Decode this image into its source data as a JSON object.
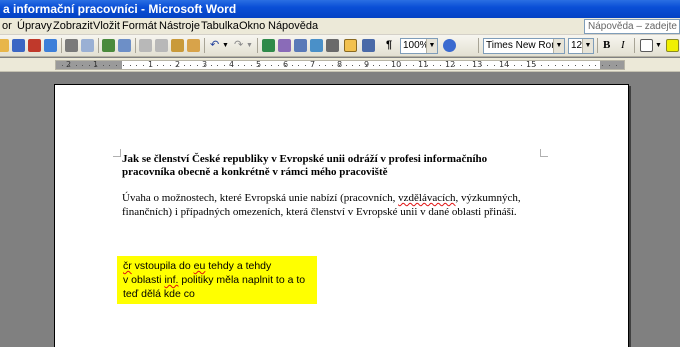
{
  "window": {
    "title": "a informační pracovníci - Microsoft Word"
  },
  "menu": {
    "items": [
      "or",
      "Úpravy",
      "Zobrazit",
      "Vložit",
      "Formát",
      "Nástroje",
      "Tabulka",
      "Okno",
      "Nápověda"
    ],
    "help_placeholder": "Nápověda – zadejte dotaz"
  },
  "toolbar": {
    "zoom": "100%",
    "font_name": "Times New Roman",
    "font_size": "12",
    "bold_label": "B",
    "italic_label": "I",
    "pilcrow": "¶"
  },
  "ruler": {
    "numbers": [
      "2",
      "1",
      "1",
      "2",
      "3",
      "4",
      "5",
      "6",
      "7",
      "8",
      "9",
      "10",
      "11",
      "12",
      "13",
      "14",
      "15"
    ]
  },
  "document": {
    "heading_line1": "Jak se členství České republiky v Evropské unii odráží v profesi informačního",
    "heading_line2": "pracovníka obecně a konkrétně v rámci mého pracoviště",
    "para_line1_a": "Úvaha o možnostech, které Evropská unie nabízí (pracovních, ",
    "para_line1_b": "vzdělávacích",
    "para_line1_c": ", výzkumných,",
    "para_line2": "finančních) i případných omezeních, která členství v Evropské unii v dané oblasti přináší.",
    "note_line1_a": "čr",
    "note_line1_b": " vstoupila do ",
    "note_line1_c": "eu",
    "note_line1_d": " tehdy a tehdy",
    "note_line2_a": "v oblasti ",
    "note_line2_b": "inf.",
    "note_line2_c": " politiky měla naplnit to a to",
    "note_line3": "teď dělá kde co"
  },
  "colors": {
    "title_bar": "#0a4fd6",
    "highlight": "#ffff00",
    "spell_error": "#e01010"
  }
}
